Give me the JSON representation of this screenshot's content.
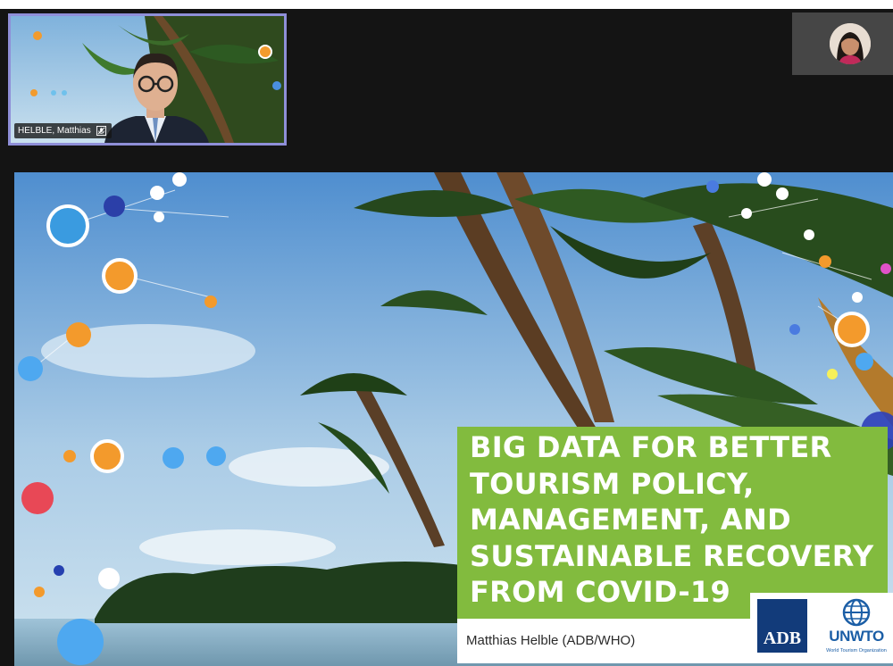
{
  "meeting": {
    "participants": [
      {
        "name": "HELBLE, Matthias",
        "tile": "active-speaker",
        "muted": true
      }
    ],
    "self_view": {
      "avatar": "participant-avatar"
    }
  },
  "slide": {
    "title": "BIG DATA FOR BETTER\nTOURISM POLICY,\nMANAGEMENT, AND\nSUSTAINABLE RECOVERY\nFROM COVID-19",
    "presenter": "Matthias Helble (ADB/WHO)",
    "logos": {
      "adb": "ADB",
      "unwto": "UNWTO",
      "unwto_subtitle": "World Tourism Organization"
    }
  },
  "colors": {
    "title_box": "#82bb3e",
    "tile_border": "#8f8fd8",
    "adb_blue": "#123b7a",
    "unwto_blue": "#1b5ea6"
  },
  "icons": [
    "mic-off-icon",
    "globe-icon"
  ]
}
